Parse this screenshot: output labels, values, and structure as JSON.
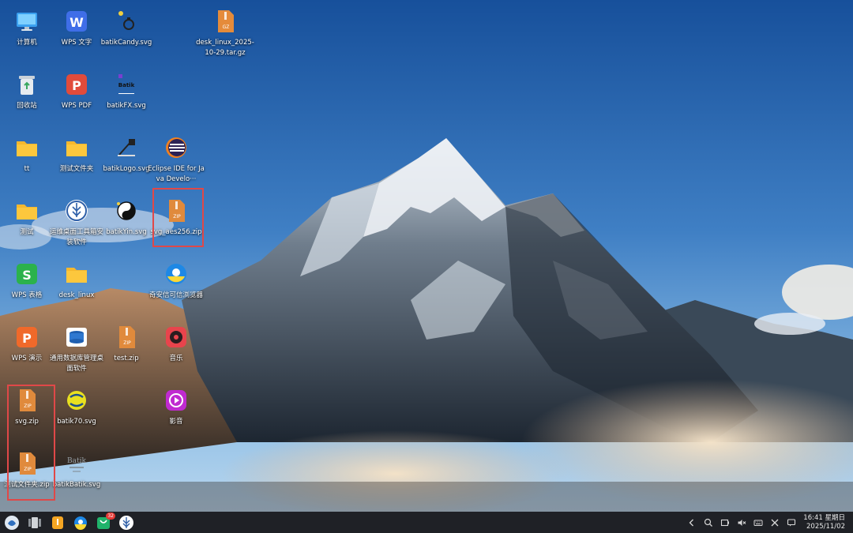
{
  "desktop": {
    "icons": [
      {
        "label": "计算机",
        "icon": "computer-icon"
      },
      {
        "label": "WPS 文字",
        "icon": "wps-writer-icon"
      },
      {
        "label": "batikCandy.svg",
        "icon": "svg-file-icon"
      },
      {
        "label": "desk_linux_2025-10-29.tar.gz",
        "icon": "gz-archive-icon"
      },
      {
        "label": "回收站",
        "icon": "trash-icon"
      },
      {
        "label": "WPS PDF",
        "icon": "wps-pdf-icon"
      },
      {
        "label": "batikFX.svg",
        "icon": "svg-file-icon"
      },
      {
        "label": "tt",
        "icon": "folder-icon"
      },
      {
        "label": "测试文件夹",
        "icon": "folder-icon"
      },
      {
        "label": "batikLogo.svg",
        "icon": "svg-file-icon"
      },
      {
        "label": "Eclipse IDE for Java Develo···",
        "icon": "eclipse-icon"
      },
      {
        "label": "测试",
        "icon": "folder-icon"
      },
      {
        "label": "运维桌面工具箱安装软件",
        "icon": "toolbox-icon"
      },
      {
        "label": "batikYin.svg",
        "icon": "svg-file-icon"
      },
      {
        "label": "svg_aes256.zip",
        "icon": "zip-icon"
      },
      {
        "label": "WPS 表格",
        "icon": "wps-sheets-icon"
      },
      {
        "label": "desk_linux",
        "icon": "folder-icon"
      },
      {
        "label": "奇安信可信浏览器",
        "icon": "browser-icon"
      },
      {
        "label": "WPS 演示",
        "icon": "wps-presentation-icon"
      },
      {
        "label": "通用数据库管理桌面软件",
        "icon": "database-icon"
      },
      {
        "label": "test.zip",
        "icon": "zip-icon"
      },
      {
        "label": "音乐",
        "icon": "music-icon"
      },
      {
        "label": "svg.zip",
        "icon": "zip-icon"
      },
      {
        "label": "batik70.svg",
        "icon": "svg-file-icon"
      },
      {
        "label": "影音",
        "icon": "video-player-icon"
      },
      {
        "label": "测试文件夹.zip",
        "icon": "zip-icon"
      },
      {
        "label": "batikBatik.svg",
        "icon": "svg-file-icon"
      }
    ],
    "zip_badge": "ZIP",
    "gz_badge": "GZ",
    "batik_text": "Batik"
  },
  "taskbar": {
    "apps": [
      {
        "name": "launcher",
        "icon": "launcher-icon"
      },
      {
        "name": "multitask",
        "icon": "multitask-icon"
      },
      {
        "name": "file-manager",
        "icon": "file-manager-icon"
      },
      {
        "name": "browser",
        "icon": "browser-icon"
      },
      {
        "name": "app-store",
        "icon": "app-store-icon",
        "badge": "32"
      },
      {
        "name": "toolbox",
        "icon": "toolbox-icon"
      }
    ],
    "tray": [
      "chevron-left-icon",
      "search-icon",
      "screen-capture-icon",
      "volume-muted-icon",
      "keyboard-icon",
      "x-icon",
      "notification-icon"
    ],
    "time": "16:41 星期日",
    "date": "2025/11/02"
  },
  "colors": {
    "sky_top": "#1b5aa8",
    "sky_bottom": "#7fb3e0",
    "highlight": "#e04848",
    "folder": "#f5b82e",
    "zip": "#e08a3c",
    "taskbar": "#1f2126"
  }
}
